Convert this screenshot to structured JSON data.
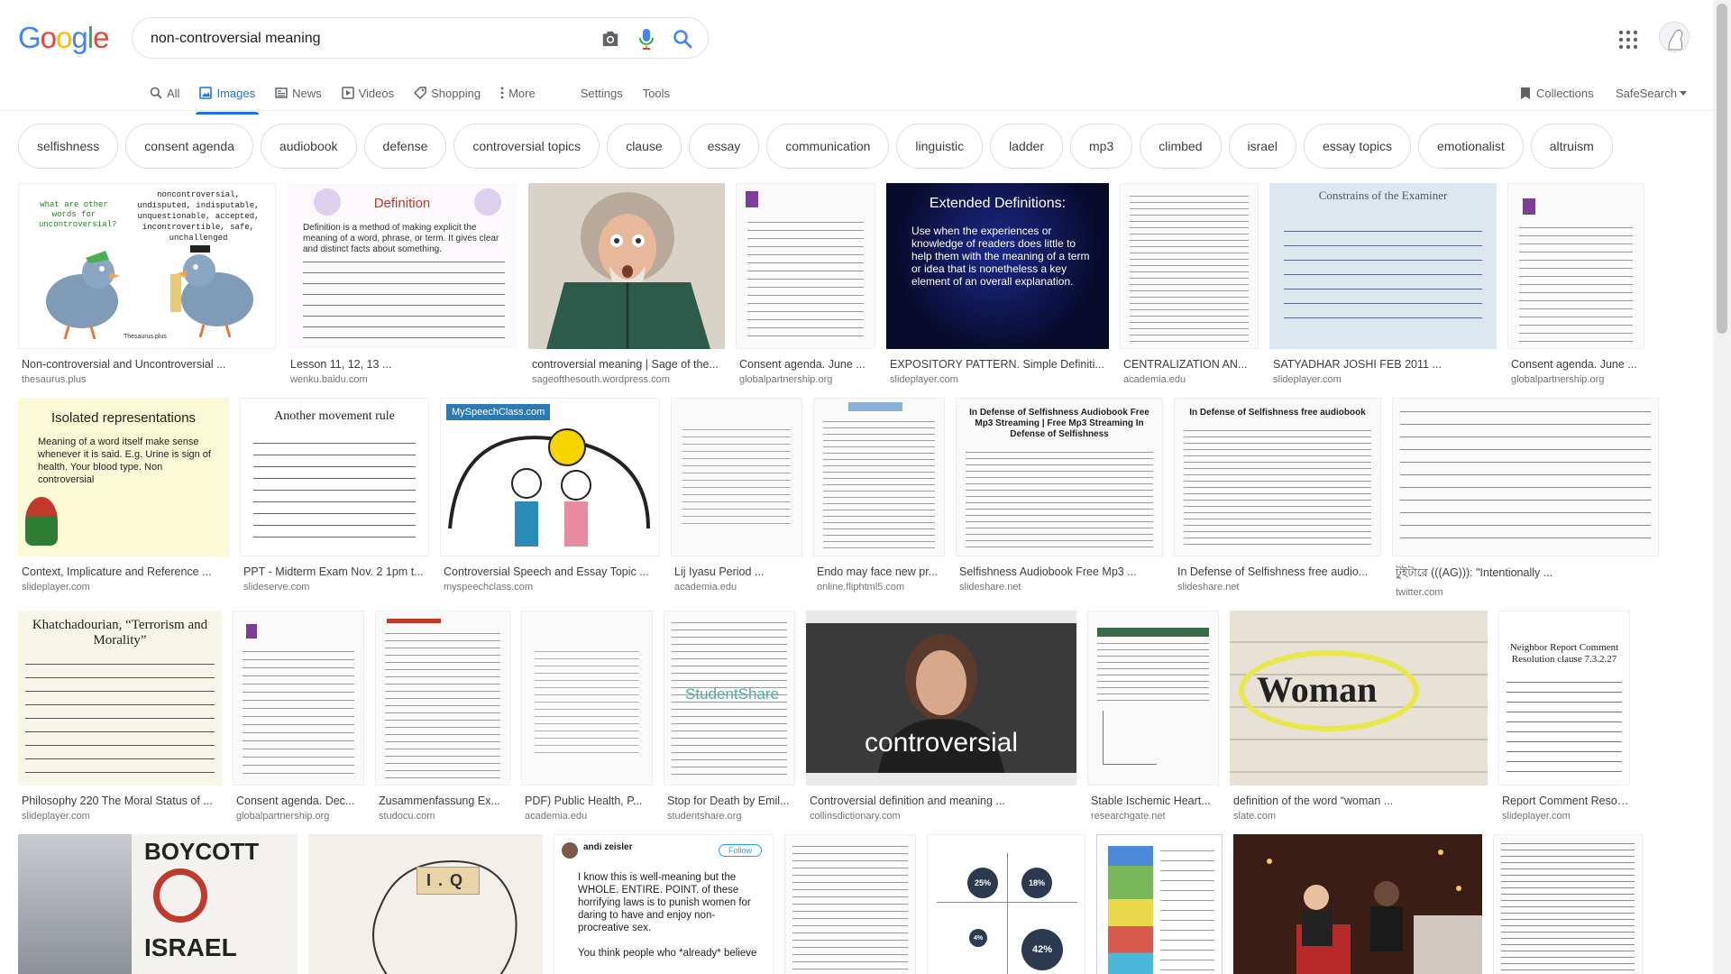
{
  "logo": {
    "letters": [
      "G",
      "o",
      "o",
      "g",
      "l",
      "e"
    ],
    "colors": [
      "#4285f4",
      "#ea4335",
      "#fbbc05",
      "#4285f4",
      "#34a853",
      "#ea4335"
    ]
  },
  "search": {
    "value": "non-controversial meaning",
    "camera_icon": "camera-icon",
    "mic_icon": "mic-icon",
    "search_icon": "search-icon"
  },
  "tabs": [
    {
      "label": "All",
      "icon": "search-icon",
      "active": false
    },
    {
      "label": "Images",
      "icon": "image-icon",
      "active": true
    },
    {
      "label": "News",
      "icon": "news-icon",
      "active": false
    },
    {
      "label": "Videos",
      "icon": "video-icon",
      "active": false
    },
    {
      "label": "Shopping",
      "icon": "tag-icon",
      "active": false
    },
    {
      "label": "More",
      "icon": "more-vert-icon",
      "active": false
    }
  ],
  "tools": {
    "settings": "Settings",
    "tools": "Tools",
    "collections": "Collections",
    "safesearch": "SafeSearch"
  },
  "chips": [
    "selfishness",
    "consent agenda",
    "audiobook",
    "defense",
    "controversial topics",
    "clause",
    "essay",
    "communication",
    "linguistic",
    "ladder",
    "mp3",
    "climbed",
    "israel",
    "essay topics",
    "emotionalist",
    "altruism"
  ],
  "results": [
    [
      {
        "caption": "Non-controversial and Uncontroversial ...",
        "source": "thesaurus.plus",
        "thumb_title": "noncontroversial, undisputed, indisputable, unquestionable, accepted, incontrovertible, safe, unchallenged",
        "thumb_sub": "what are other words for uncontroversial?",
        "brand": "Thesaurus.plus"
      },
      {
        "caption": "Lesson 11, 12, 13 ...",
        "source": "wenku.baidu.com",
        "thumb_title": "Definition",
        "thumb_sub": "Definition is a method of making explicit the meaning of a word, phrase, or term. It gives clear and distinct facts about something."
      },
      {
        "caption": "controversial meaning | Sage of the...",
        "source": "sageofthesouth.wordpress.com"
      },
      {
        "caption": "Consent agenda. June ...",
        "source": "globalpartnership.org"
      },
      {
        "caption": "EXPOSITORY PATTERN. Simple Definiti...",
        "source": "slideplayer.com",
        "thumb_title": "Extended Definitions:",
        "thumb_sub": "Use when the experiences or knowledge of readers does little to help them with the meaning of a term or idea that is nonetheless a key element of an overall explanation."
      },
      {
        "caption": "CENTRALIZATION AN...",
        "source": "academia.edu"
      },
      {
        "caption": "SATYADHAR JOSHI FEB 2011 ...",
        "source": "slideplayer.com",
        "thumb_title": "Constrains of the Examiner"
      },
      {
        "caption": "Consent agenda. June ...",
        "source": "globalpartnership.org"
      }
    ],
    [
      {
        "caption": "Context, Implicature and Reference ...",
        "source": "slideplayer.com",
        "thumb_title": "Isolated representations",
        "thumb_sub": "Meaning of a word itself make sense whenever it is said. E.g. Urine is sign of health. Your blood type. Non controversial"
      },
      {
        "caption": "PPT - Midterm Exam Nov. 2 1pm t...",
        "source": "slideserve.com",
        "thumb_title": "Another movement rule"
      },
      {
        "caption": "Controversial Speech and Essay Topic ...",
        "source": "myspeechclass.com",
        "brand": "MySpeechClass.com"
      },
      {
        "caption": "Lij Iyasu Period ...",
        "source": "academia.edu"
      },
      {
        "caption": "Endo may face new pr...",
        "source": "online.fliphtml5.com"
      },
      {
        "caption": "Selfishness Audiobook Free Mp3 ...",
        "source": "slideshare.net",
        "thumb_title": "In Defense of Selfishness Audiobook Free Mp3 Streaming | Free Mp3 Streaming In Defense of Selfishness"
      },
      {
        "caption": "In Defense of Selfishness free audio...",
        "source": "slideshare.net",
        "thumb_title": "In Defense of Selfishness free audiobook"
      },
      {
        "caption": "টুইটারে (((AG))): \"Intentionally ...",
        "source": "twitter.com"
      }
    ],
    [
      {
        "caption": "Philosophy 220 The Moral Status of ...",
        "source": "slideplayer.com",
        "thumb_title": "Khatchadourian, “Terrorism and Morality”"
      },
      {
        "caption": "Consent agenda. Dec...",
        "source": "globalpartnership.org"
      },
      {
        "caption": "Zusammenfassung Ex...",
        "source": "studocu.com"
      },
      {
        "caption": "PDF) Public Health, P...",
        "source": "academia.edu"
      },
      {
        "caption": "Stop for Death by Emil...",
        "source": "studentshare.org",
        "brand": "StudentShare"
      },
      {
        "caption": "Controversial definition and meaning ...",
        "source": "collinsdictionary.com",
        "thumb_title": "controversial"
      },
      {
        "caption": "Stable Ischemic Heart...",
        "source": "researchgate.net"
      },
      {
        "caption": "definition of the word “woman ...",
        "source": "slate.com",
        "thumb_title": "Woman"
      },
      {
        "caption": "Report Comment Resolution ...",
        "source": "slideplayer.com",
        "thumb_title": "Neighbor Report Comment Resolution clause 7.3.2.27"
      }
    ],
    [
      {
        "caption": "",
        "source": "",
        "thumb_title": "BOYCOTT",
        "thumb_sub": "ISRAEL"
      },
      {
        "caption": "",
        "source": "",
        "thumb_title": "I.Q"
      },
      {
        "caption": "",
        "source": "",
        "thumb_title": "andi zeisler",
        "thumb_sub": "I know this is well-meaning but the WHOLE. ENTIRE. POINT. of these horrifying laws is to punish women for daring to have and enjoy non-procreative sex.",
        "thumb_extra": "You think people who *already* believe",
        "follow": "Follow"
      },
      {
        "caption": "",
        "source": ""
      },
      {
        "caption": "",
        "source": "",
        "stats": [
          "25%",
          "18%",
          "4%",
          "42%"
        ]
      },
      {
        "caption": "",
        "source": ""
      },
      {
        "caption": "",
        "source": ""
      },
      {
        "caption": "",
        "source": ""
      }
    ]
  ]
}
